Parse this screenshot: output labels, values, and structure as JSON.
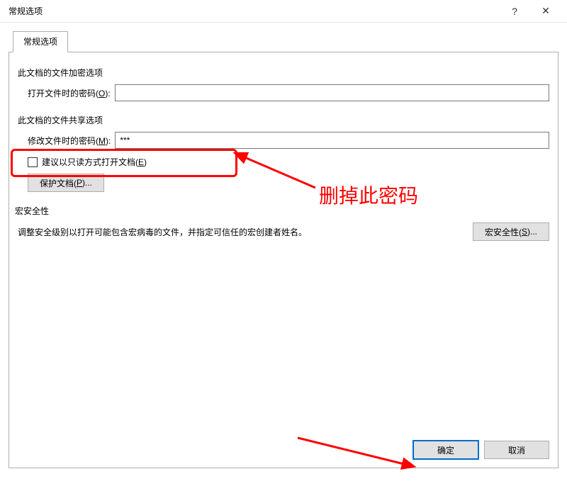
{
  "window": {
    "title": "常规选项",
    "help": "?",
    "close": "✕"
  },
  "tab": {
    "label": "常规选项"
  },
  "encryption": {
    "section": "此文档的文件加密选项",
    "open_label_pre": "打开文件时的密码(",
    "open_key": "O",
    "open_label_post": "):",
    "open_value": ""
  },
  "sharing": {
    "section": "此文档的文件共享选项",
    "modify_label_pre": "修改文件时的密码(",
    "modify_key": "M",
    "modify_label_post": "):",
    "modify_value": "***",
    "readonly_label_pre": "建议以只读方式打开文档(",
    "readonly_key": "E",
    "readonly_label_post": ")",
    "protect_label_pre": "保护文档(",
    "protect_key": "P",
    "protect_label_post": ")..."
  },
  "macro": {
    "section": "宏安全性",
    "description": "调整安全级别以打开可能包含宏病毒的文件，并指定可信任的宏创建者姓名。",
    "button_pre": "宏安全性(",
    "button_key": "S",
    "button_post": ")..."
  },
  "footer": {
    "ok": "确定",
    "cancel": "取消"
  },
  "annotation": {
    "callout": "删掉此密码"
  }
}
